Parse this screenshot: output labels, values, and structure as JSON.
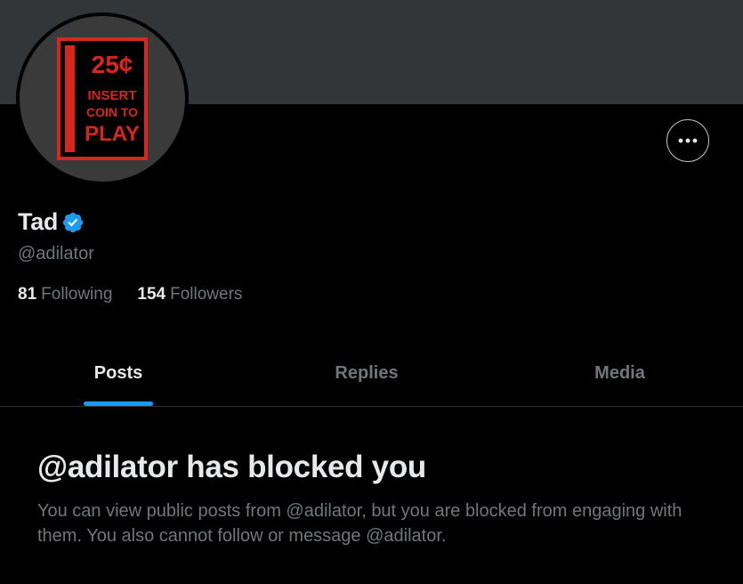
{
  "profile": {
    "display_name": "Tad",
    "handle": "@adilator",
    "verified": true,
    "avatar": {
      "top_text": "25¢",
      "line1": "INSERT",
      "line2": "COIN TO",
      "line3": "PLAY",
      "accent_color": "#d7261e"
    }
  },
  "stats": {
    "following_count": "81",
    "following_label": "Following",
    "followers_count": "154",
    "followers_label": "Followers"
  },
  "tabs": [
    {
      "label": "Posts",
      "active": true
    },
    {
      "label": "Replies",
      "active": false
    },
    {
      "label": "Media",
      "active": false
    }
  ],
  "blocked": {
    "title": "@adilator has blocked you",
    "description": "You can view public posts from @adilator, but you are blocked from engaging with them. You also cannot follow or message @adilator."
  },
  "icons": {
    "more": "more-horizontal-icon",
    "verified": "verified-badge-icon"
  },
  "colors": {
    "background": "#000000",
    "banner": "#333639",
    "primary_text": "#e7e9ea",
    "secondary_text": "#71767b",
    "accent": "#1d9bf0"
  }
}
